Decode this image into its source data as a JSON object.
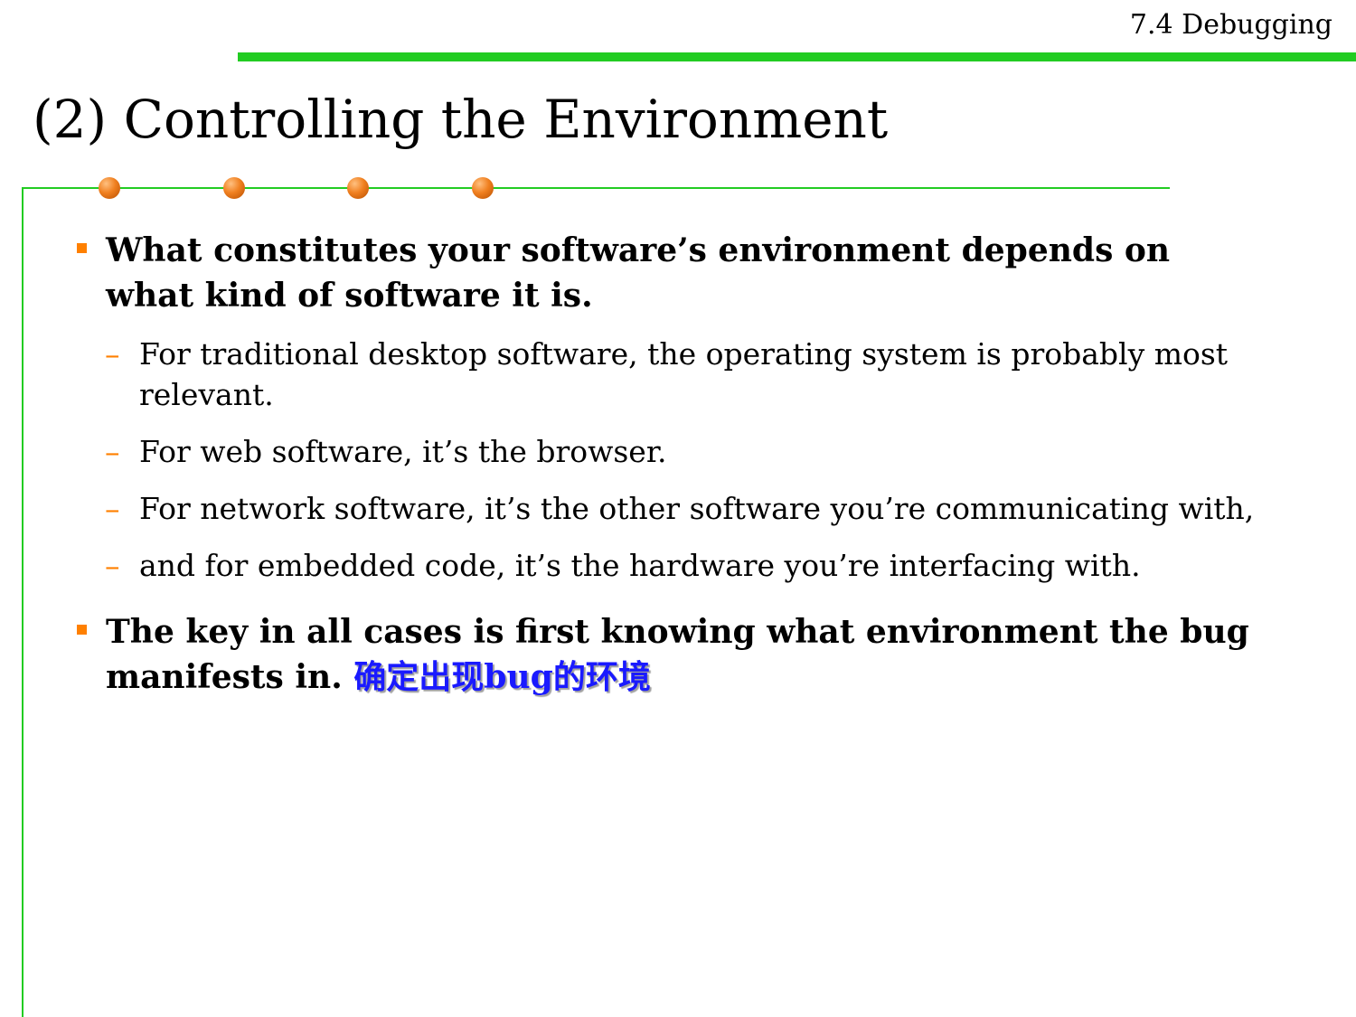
{
  "header": {
    "section_label": "7.4 Debugging"
  },
  "title": "(2) Controlling the Environment",
  "colors": {
    "rule": "#22cc22",
    "bullet": "#ff8000",
    "highlight": "#1a1aff"
  },
  "bullets": [
    {
      "text": "What constitutes your software’s environment depends on what kind of software it is.",
      "subitems": [
        "For traditional desktop software, the operating system is probably most relevant.",
        "For web software, it’s the browser.",
        "For network software, it’s the other software you’re communicating with,",
        "and for embedded code, it’s the hardware you’re interfacing with."
      ]
    },
    {
      "text": "The key in all cases is first knowing what environment the bug manifests in.",
      "highlight": "确定出现bug的环境"
    }
  ]
}
